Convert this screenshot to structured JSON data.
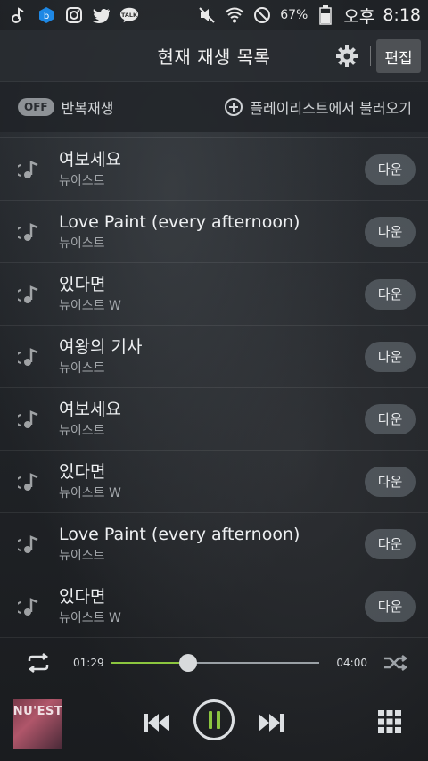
{
  "status_bar": {
    "battery_percent": "67%",
    "ampm": "오후",
    "time": "8:18"
  },
  "header": {
    "title": "현재 재생 목록",
    "edit_label": "편집"
  },
  "options": {
    "repeat_state": "OFF",
    "repeat_label": "반복재생",
    "load_playlist_label": "플레이리스트에서 불러오기"
  },
  "tracks": [
    {
      "title": "여보세요",
      "artist": "뉴이스트",
      "action": "다운"
    },
    {
      "title": "Love Paint (every afternoon)",
      "artist": "뉴이스트",
      "action": "다운"
    },
    {
      "title": "있다면",
      "artist": "뉴이스트 W",
      "action": "다운"
    },
    {
      "title": "여왕의 기사",
      "artist": "뉴이스트",
      "action": "다운"
    },
    {
      "title": "여보세요",
      "artist": "뉴이스트",
      "action": "다운"
    },
    {
      "title": "있다면",
      "artist": "뉴이스트 W",
      "action": "다운"
    },
    {
      "title": "Love Paint (every afternoon)",
      "artist": "뉴이스트",
      "action": "다운"
    },
    {
      "title": "있다면",
      "artist": "뉴이스트 W",
      "action": "다운"
    }
  ],
  "playback": {
    "elapsed": "01:29",
    "duration": "04:00",
    "progress_fraction": 0.37
  },
  "album_art_text": "NU'EST",
  "colors": {
    "accent": "#8cc63f"
  }
}
